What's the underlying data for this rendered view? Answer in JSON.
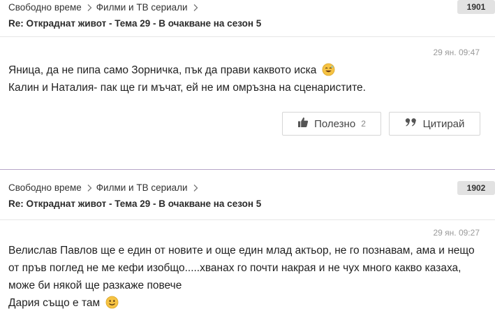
{
  "posts": [
    {
      "breadcrumb": [
        "Свободно време",
        "Филми и ТВ сериали"
      ],
      "number": "1901",
      "title": "Re: Откраднат живот - Тема 29 - В очакване на сезон 5",
      "timestamp": "29 ян. 09:47",
      "lines": [
        "Яница, да не пипа само Зорничка, пък да прави каквото иска",
        "Калин и Наталия- пак ще ги мъчат, ей не им омръзна на сценаристите."
      ],
      "useful_label": "Полезно",
      "useful_count": "2",
      "quote_label": "Цитирай"
    },
    {
      "breadcrumb": [
        "Свободно време",
        "Филми и ТВ сериали"
      ],
      "number": "1902",
      "title": "Re: Откраднат живот - Тема 29 - В очакване на сезон 5",
      "timestamp": "29 ян. 09:27",
      "paragraph": "Велислав Павлов  ще е един от новите и още един млад актьор, не го познавам, ама и нещо от пръв поглед не ме кефи изобщо.....хванах го почти накрая и не чух много какво казаха, може би някой ще разкаже повече",
      "last_line": "Дария също е там"
    }
  ],
  "colors": {
    "accent_divider": "#b7a6c9",
    "badge_bg": "#e2e2e2",
    "emoji": "#f6c343"
  },
  "icons": [
    "chevron-right-icon",
    "thumbs-up-icon",
    "quote-icon",
    "sweat-smile-emoji-icon",
    "smile-emoji-icon"
  ]
}
